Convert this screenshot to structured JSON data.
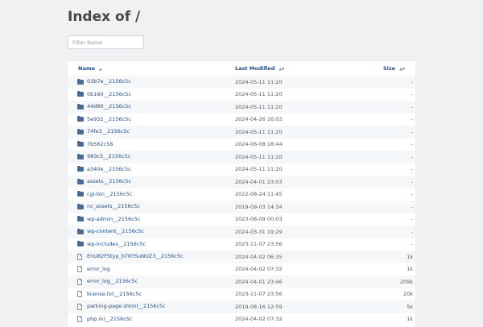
{
  "page": {
    "title": "Index of /",
    "filter_placeholder": "Filter Name"
  },
  "table": {
    "headers": {
      "name": "Name",
      "modified": "Last Modified",
      "size": "Size"
    },
    "sort_glyphs": {
      "name": "▲",
      "modified": "▲▼",
      "size": "▲▼"
    },
    "rows": [
      {
        "name": "03b7e__2156c5c",
        "modified": "2024-05-11 11:20",
        "size": "-",
        "type": "folder"
      },
      {
        "name": "0b160__2156c5c",
        "modified": "2024-05-11 11:20",
        "size": "-",
        "type": "folder"
      },
      {
        "name": "44d90__2156c5c",
        "modified": "2024-05-11 11:20",
        "size": "-",
        "type": "folder"
      },
      {
        "name": "5e932__2156c5c",
        "modified": "2024-04-26 16:03",
        "size": "-",
        "type": "folder"
      },
      {
        "name": "74fe3__2156c5c",
        "modified": "2024-05-11 11:20",
        "size": "-",
        "type": "folder"
      },
      {
        "name": "7b562c56",
        "modified": "2024-06-08 18:44",
        "size": "-",
        "type": "folder"
      },
      {
        "name": "983c5__2156c5c",
        "modified": "2024-05-11 11:20",
        "size": "-",
        "type": "folder"
      },
      {
        "name": "a340e__2156c5c",
        "modified": "2024-05-11 11:20",
        "size": "-",
        "type": "folder"
      },
      {
        "name": "assets__2156c5c",
        "modified": "2024-04-01 23:03",
        "size": "-",
        "type": "folder"
      },
      {
        "name": "cgi-bin__2156c5c",
        "modified": "2022-08-24 11:45",
        "size": "-",
        "type": "folder"
      },
      {
        "name": "nc_assets__2156c5c",
        "modified": "2019-09-03 14:34",
        "size": "-",
        "type": "folder"
      },
      {
        "name": "wp-admin__2156c5c",
        "modified": "2023-08-09 00:03",
        "size": "-",
        "type": "folder"
      },
      {
        "name": "wp-content__2156c5c",
        "modified": "2024-03-31 19:29",
        "size": "-",
        "type": "folder"
      },
      {
        "name": "wp-includes__2156c5c",
        "modified": "2023-11-07 23:56",
        "size": "-",
        "type": "folder"
      },
      {
        "name": "EnU82FStyp_b7KYSuNUZ3__2156c5c",
        "modified": "2024-04-02 06:35",
        "size": "1k",
        "type": "file"
      },
      {
        "name": "error_log",
        "modified": "2024-04-02 07:32",
        "size": "1k",
        "type": "file"
      },
      {
        "name": "error_log__2156c5c",
        "modified": "2024-04-01 23:46",
        "size": "209k",
        "type": "file"
      },
      {
        "name": "license.txt__2156c5c",
        "modified": "2023-11-07 23:56",
        "size": "20k",
        "type": "file"
      },
      {
        "name": "parking-page.shtml__2156c5c",
        "modified": "2019-08-16 12:59",
        "size": "5k",
        "type": "file"
      },
      {
        "name": "php.ini__2156c5c",
        "modified": "2024-04-02 07:32",
        "size": "1k",
        "type": "file"
      }
    ]
  },
  "colors": {
    "link": "#1f4e8c",
    "folder_icon": "#4a6a90",
    "background": "#f1f1f4"
  }
}
